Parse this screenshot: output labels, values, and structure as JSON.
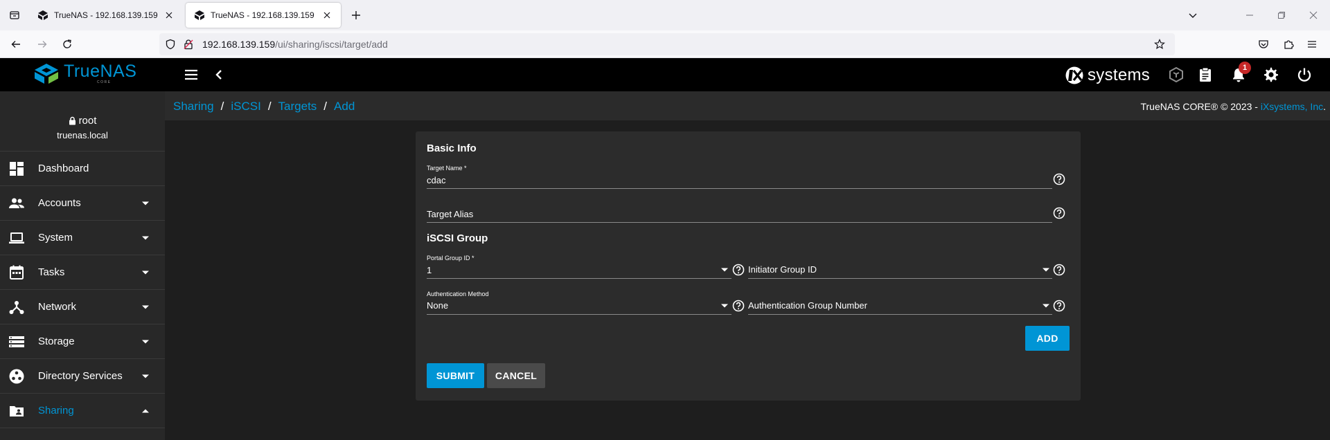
{
  "browser": {
    "tabs": [
      {
        "title": "TrueNAS - 192.168.139.159",
        "active": false
      },
      {
        "title": "TrueNAS - 192.168.139.159",
        "active": true
      }
    ],
    "url": {
      "host": "192.168.139.159",
      "path": "/ui/sharing/iscsi/target/add"
    }
  },
  "app": {
    "logo_text": "TrueNAS",
    "logo_sub": "CORE",
    "vendor_logo": "systems",
    "notifications_count": "1",
    "icons": {
      "menu": "hamburger-icon",
      "back": "chevron-left-icon",
      "truecommand": "truecommand-icon",
      "tasks": "clipboard-icon",
      "notifications": "bell-icon",
      "settings": "gear-icon",
      "power": "power-icon"
    }
  },
  "sidebar": {
    "user": "root",
    "hostname": "truenas.local",
    "items": [
      {
        "label": "Dashboard",
        "icon": "dashboard-icon",
        "expandable": false,
        "active": false
      },
      {
        "label": "Accounts",
        "icon": "accounts-icon",
        "expandable": true,
        "active": false
      },
      {
        "label": "System",
        "icon": "laptop-icon",
        "expandable": true,
        "active": false
      },
      {
        "label": "Tasks",
        "icon": "calendar-icon",
        "expandable": true,
        "active": false
      },
      {
        "label": "Network",
        "icon": "network-icon",
        "expandable": true,
        "active": false
      },
      {
        "label": "Storage",
        "icon": "storage-icon",
        "expandable": true,
        "active": false
      },
      {
        "label": "Directory Services",
        "icon": "directory-services-icon",
        "expandable": true,
        "active": false
      },
      {
        "label": "Sharing",
        "icon": "sharing-folder-icon",
        "expandable": true,
        "active": true
      }
    ]
  },
  "breadcrumb": [
    "Sharing",
    "iSCSI",
    "Targets",
    "Add"
  ],
  "copyright": {
    "prefix": "TrueNAS CORE® © 2023 - ",
    "link": "iXsystems, Inc",
    "suffix": "."
  },
  "form": {
    "basic_info_title": "Basic Info",
    "target_name": {
      "label": "Target Name *",
      "value": "cdac"
    },
    "target_alias": {
      "placeholder": "Target Alias",
      "value": ""
    },
    "iscsi_group_title": "iSCSI Group",
    "portal_group_id": {
      "label": "Portal Group ID *",
      "value": "1"
    },
    "initiator_group_id": {
      "placeholder": "Initiator Group ID",
      "value": ""
    },
    "authentication_method": {
      "label": "Authentication Method",
      "value": "None"
    },
    "authentication_group_number": {
      "placeholder": "Authentication Group Number",
      "value": ""
    },
    "add_label": "ADD",
    "submit_label": "SUBMIT",
    "cancel_label": "CANCEL"
  },
  "colors": {
    "accent": "#0095d5",
    "topbar": "#000000",
    "sidebar": "#282828",
    "card": "#2c2c2c",
    "badge": "#c62828"
  }
}
